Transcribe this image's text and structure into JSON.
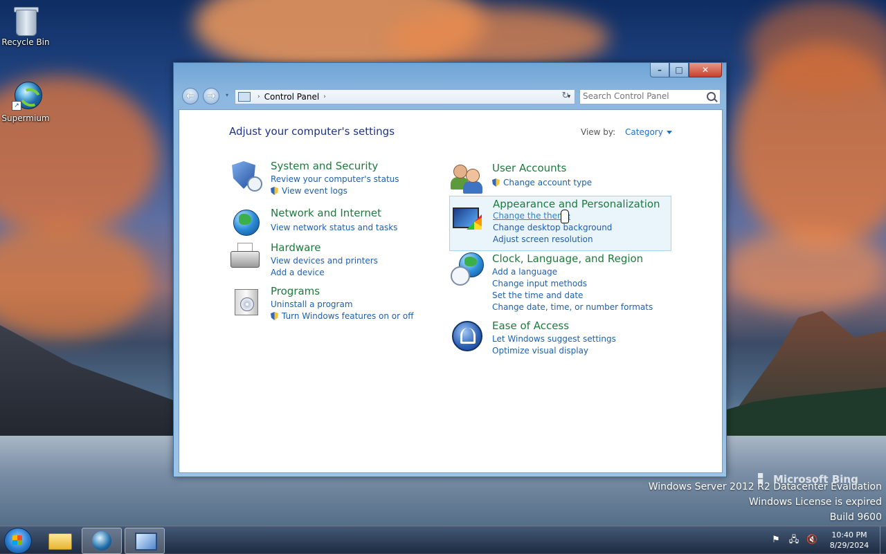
{
  "desktop": {
    "icons": [
      {
        "label": "Recycle Bin",
        "icon": "recycle-bin-icon"
      },
      {
        "label": "Supermium",
        "icon": "supermium-browser-icon"
      }
    ],
    "watermark": {
      "brand": "Microsoft Bing",
      "line1": "Windows Server 2012 R2 Datacenter Evaluation",
      "line2": "Windows License is expired",
      "line3": "Build 9600"
    }
  },
  "window": {
    "title_buttons": {
      "minimize": "–",
      "maximize": "□",
      "close": "✕"
    },
    "nav": {
      "back": "←",
      "forward": "→",
      "recent": "▾"
    },
    "address": {
      "crumb": "Control Panel",
      "separator": "›",
      "dropdown": "▾"
    },
    "refresh_glyph": "↻",
    "search": {
      "placeholder": "Search Control Panel",
      "value": ""
    },
    "heading": "Adjust your computer's settings",
    "view_by": {
      "label": "View by:",
      "value": "Category"
    }
  },
  "categories": {
    "system": {
      "title": "System and Security",
      "links": [
        "Review your computer's status",
        "View event logs"
      ],
      "icon": "shield-icon"
    },
    "network": {
      "title": "Network and Internet",
      "links": [
        "View network status and tasks"
      ],
      "icon": "network-globe-icon"
    },
    "hardware": {
      "title": "Hardware",
      "links": [
        "View devices and printers",
        "Add a device"
      ],
      "icon": "printer-icon"
    },
    "programs": {
      "title": "Programs",
      "links": [
        "Uninstall a program",
        "Turn Windows features on or off"
      ],
      "icon": "programs-disc-icon"
    },
    "users": {
      "title": "User Accounts",
      "links": [
        "Change account type"
      ],
      "icon": "users-icon"
    },
    "appearance": {
      "title": "Appearance and Personalization",
      "links": [
        "Change the theme",
        "Change desktop background",
        "Adjust screen resolution"
      ],
      "icon": "display-palette-icon"
    },
    "clock": {
      "title": "Clock, Language, and Region",
      "links": [
        "Add a language",
        "Change input methods",
        "Set the time and date",
        "Change date, time, or number formats"
      ],
      "icon": "globe-clock-icon"
    },
    "ease": {
      "title": "Ease of Access",
      "links": [
        "Let Windows suggest settings",
        "Optimize visual display"
      ],
      "icon": "ease-of-access-icon"
    }
  },
  "taskbar": {
    "items": [
      {
        "name": "start-button",
        "icon": "windows-start-icon"
      },
      {
        "name": "file-explorer",
        "icon": "folder-icon"
      },
      {
        "name": "supermium",
        "icon": "supermium-browser-icon"
      },
      {
        "name": "control-panel",
        "icon": "control-panel-icon",
        "active": true
      }
    ],
    "tray": {
      "flag": "⚑",
      "network": "🖧",
      "volume": "🔇"
    },
    "clock": {
      "time": "10:40 PM",
      "date": "8/29/2024"
    }
  },
  "colors": {
    "category_title": "#1c7b3b",
    "link": "#1e5fae",
    "heading": "#1e3287",
    "highlight_bg": "#e9f4fb"
  }
}
